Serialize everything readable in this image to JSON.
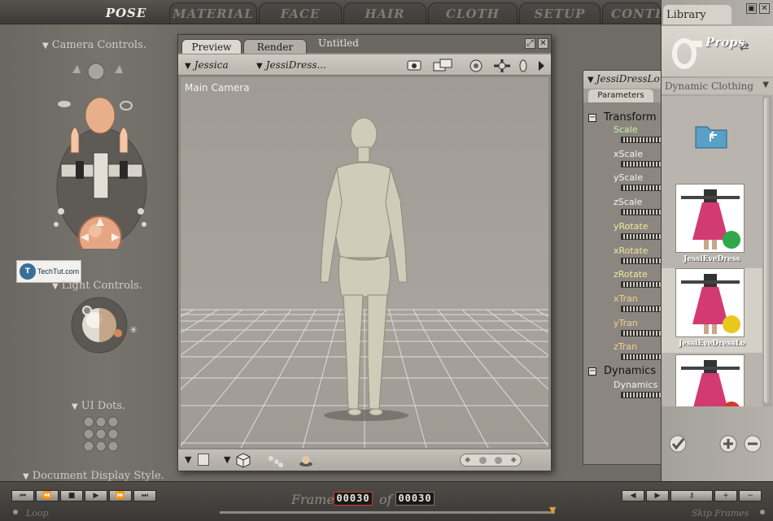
{
  "tabs": [
    "POSE",
    "MATERIAL",
    "FACE",
    "HAIR",
    "CLOTH",
    "SETUP",
    "CONTENT"
  ],
  "left_panel": {
    "camera_controls": "Camera Controls.",
    "light_controls": "Light Controls.",
    "ui_dots": "UI Dots.",
    "document_display_style": "Document Display Style.",
    "watermark": "TechTut.com"
  },
  "preview": {
    "tab_preview": "Preview",
    "tab_render": "Render",
    "doc_title": "Untitled",
    "figure_select": "Jessica",
    "actor_select": "JessiDress...",
    "camera_label": "Main Camera"
  },
  "parameters": {
    "object_name": "JessiDressLo",
    "tab": "Parameters",
    "groups": [
      {
        "name": "Transform",
        "params": [
          {
            "label": "Scale",
            "color": "#c8f0a0"
          },
          {
            "label": "xScale",
            "color": "#f4f2ee"
          },
          {
            "label": "yScale",
            "color": "#f4f2ee"
          },
          {
            "label": "zScale",
            "color": "#f4f2ee"
          },
          {
            "label": "yRotate",
            "color": "#f3e79a"
          },
          {
            "label": "xRotate",
            "color": "#f3e79a"
          },
          {
            "label": "zRotate",
            "color": "#f3e79a"
          },
          {
            "label": "xTran",
            "color": "#f3cf8a"
          },
          {
            "label": "yTran",
            "color": "#f3cf8a"
          },
          {
            "label": "zTran",
            "color": "#f3cf8a"
          }
        ]
      },
      {
        "name": "Dynamics",
        "params": [
          {
            "label": "Dynamics",
            "color": "#f4f2ee"
          }
        ]
      }
    ]
  },
  "library": {
    "title": "Library",
    "category": "Props",
    "subcategory": "Dynamic Clothing",
    "items": [
      {
        "label": "JessiEveDress",
        "dot": "#2ea84a"
      },
      {
        "label": "JessiEveDressLo",
        "dot": "#e9c81e"
      },
      {
        "label": "",
        "dot": "#d23a2a"
      }
    ]
  },
  "animation": {
    "frame_label": "Frame",
    "current_frame": "00030",
    "of_label": "of",
    "total_frames": "00030",
    "loop_label": "Loop",
    "skip_frames_label": "Skip Frames"
  }
}
